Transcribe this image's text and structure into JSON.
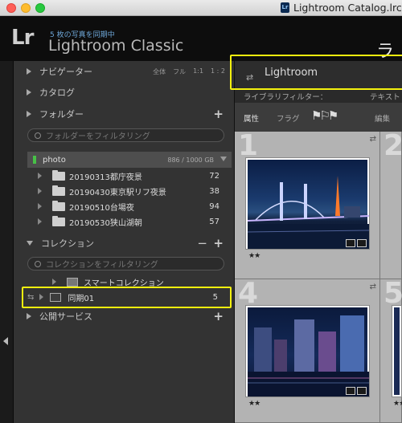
{
  "window": {
    "title": "Lightroom Catalog.lrcat"
  },
  "identity_plate": {
    "logo": "Lr",
    "sync_status": "5 枚の写真を同期中",
    "app_name": "Lightroom Classic",
    "module_picker": "ラ"
  },
  "navigator": {
    "label": "ナビゲーター",
    "zoom_options": [
      "全体",
      "フル",
      "1:1",
      "1 : 2"
    ]
  },
  "catalog": {
    "label": "カタログ"
  },
  "folders": {
    "label": "フォルダー",
    "filter_placeholder": "フォルダーをフィルタリング",
    "volume": {
      "name": "photo",
      "size": "886 / 1000 GB"
    },
    "items": [
      {
        "name": "20190313都庁夜景",
        "count": "72"
      },
      {
        "name": "20190430東京駅リフ夜景",
        "count": "38"
      },
      {
        "name": "20190510台場夜",
        "count": "94"
      },
      {
        "name": "20190530狭山湖朝",
        "count": "57"
      }
    ]
  },
  "collections": {
    "label": "コレクション",
    "filter_placeholder": "コレクションをフィルタリング",
    "smart_set": "スマートコレクション",
    "synced": {
      "name": "同期01",
      "count": "5"
    }
  },
  "publish_services": {
    "label": "公開サービス"
  },
  "content": {
    "collection_title": "Lightroom",
    "library_filter_label": "ライブラリフィルター：",
    "filter_text": "テキスト",
    "attribute_label": "属性",
    "flag_label": "フラグ",
    "edit_label": "編集",
    "cells": [
      {
        "number": "1",
        "stars": "★★"
      },
      {
        "number": "2",
        "stars": ""
      },
      {
        "number": "4",
        "stars": "★★"
      },
      {
        "number": "5",
        "stars": "★★"
      }
    ]
  }
}
